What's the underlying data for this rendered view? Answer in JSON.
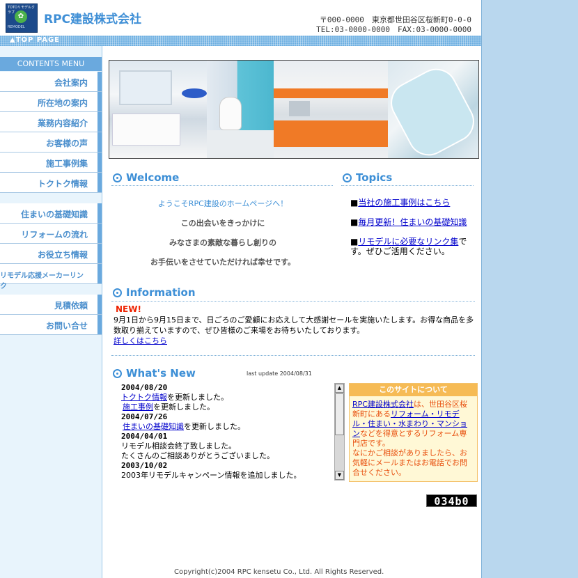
{
  "header": {
    "logo_top_text": "TOTOリモデルクラブ",
    "logo_bottom_text": "REMODEL",
    "company_name": "RPC建設株式会社",
    "address_line1": "〒000-0000　東京都世田谷区桜新町0-0-0",
    "address_line2": "TEL:03-0000-0000　FAX:03-0000-0000"
  },
  "topbar": {
    "top_page_label": "▲TOP PAGE"
  },
  "sidebar": {
    "header": "CONTENTS MENU",
    "items": [
      {
        "label": "会社案内"
      },
      {
        "label": "所在地の案内"
      },
      {
        "label": "業務内容紹介"
      },
      {
        "label": "お客様の声"
      },
      {
        "label": "施工事例集"
      },
      {
        "label": "トクトク情報"
      },
      {
        "label": "住まいの基礎知識"
      },
      {
        "label": "リフォームの流れ"
      },
      {
        "label": "お役立ち情報"
      },
      {
        "label": "リモデル応援メーカーリンク"
      },
      {
        "label": "見積依頼"
      },
      {
        "label": "お問い合せ"
      }
    ]
  },
  "welcome": {
    "title": "Welcome",
    "lines": [
      "ようこそRPC建設のホームページへ！",
      "この出会いをきっかけに",
      "みなさまの素敵な暮らし創りの",
      "お手伝いをさせていただければ幸せです。"
    ]
  },
  "topics": {
    "title": "Topics",
    "items": [
      {
        "bullet": "■",
        "link": "当社の施工事例はこちら",
        "rest": ""
      },
      {
        "bullet": "■",
        "link": "毎月更新！住まいの基礎知識",
        "rest": ""
      },
      {
        "bullet": "■",
        "link": "リモデルに必要なリンク集",
        "rest": "です。ぜひご活用ください。"
      }
    ]
  },
  "information": {
    "title": "Information",
    "badge": "NEW!",
    "text": "9月1日から9月15日まで、日ごろのご愛顧にお応えして大感謝セールを実施いたします。お得な商品を多数取り揃えていますので、ぜひ皆様のご来場をお待ちいたしております。",
    "link": "詳しくはこちら"
  },
  "whats_new": {
    "title": "What's New",
    "last_update": "last update 2004/08/31",
    "entries": [
      {
        "date": "2004/08/20"
      },
      {
        "link": "トクトク情報",
        "text": "を更新しました。"
      },
      {
        "link": "施工事例",
        "text": "を更新しました。"
      },
      {
        "date": "2004/07/26"
      },
      {
        "link": "住まいの基礎知識",
        "text": "を更新しました。"
      },
      {
        "date": "2004/04/01"
      },
      {
        "text": "リモデル相談会終了致しました。"
      },
      {
        "text": "たくさんのご相談ありがとうございました。"
      },
      {
        "date": "2003/10/02"
      },
      {
        "text": "2003年リモデルキャンペーン情報を追加しました。"
      }
    ]
  },
  "about": {
    "title": "このサイトについて",
    "link1": "RPC建設株式会社",
    "text1": "は、世田谷区桜新町にある",
    "link2": "リフォーム・リモデル・住まい・水まわり・マンション",
    "text2": "などを得意とするリフォーム専門店です。",
    "text3": "なにかご相談がありましたら、お気軽にメールまたはお電話でお問合せください。"
  },
  "counter": "034b0",
  "footer": {
    "copyright": "Copyright(c)2004 RPC kensetu Co., Ltd. All Rights Reserved."
  },
  "colors": {
    "accent": "#3d8fd6",
    "sidebar_bg": "#e8f4fc",
    "about_bg": "#fff8d6",
    "about_head": "#f6bb55",
    "new_badge": "#ee2200"
  }
}
